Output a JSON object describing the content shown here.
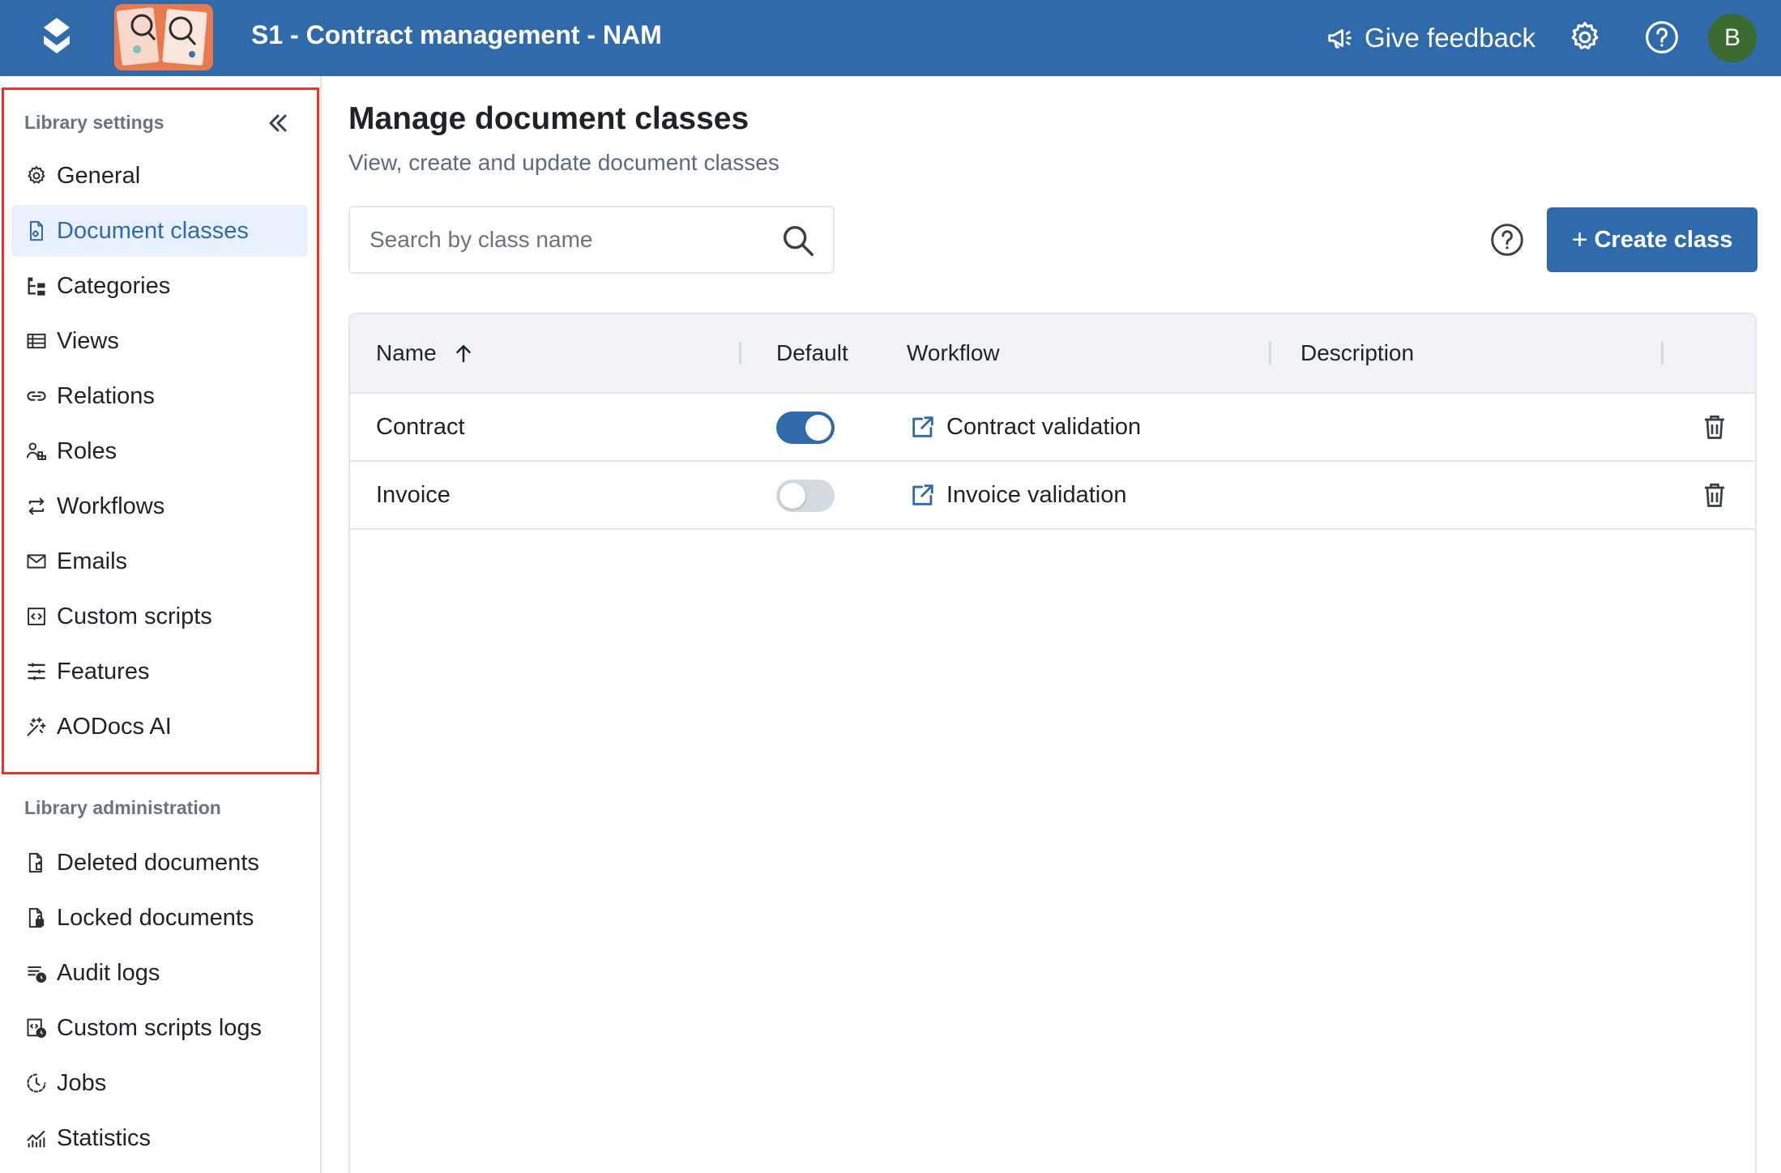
{
  "header": {
    "library_title": "S1 - Contract management - NAM",
    "feedback_label": "Give feedback",
    "avatar_initial": "B"
  },
  "sidebar": {
    "settings_title": "Library settings",
    "settings_items": [
      {
        "label": "General",
        "icon": "gear-icon"
      },
      {
        "label": "Document classes",
        "icon": "document-class-icon",
        "active": true
      },
      {
        "label": "Categories",
        "icon": "categories-icon"
      },
      {
        "label": "Views",
        "icon": "views-icon"
      },
      {
        "label": "Relations",
        "icon": "link-icon"
      },
      {
        "label": "Roles",
        "icon": "roles-icon"
      },
      {
        "label": "Workflows",
        "icon": "workflow-icon"
      },
      {
        "label": "Emails",
        "icon": "email-icon"
      },
      {
        "label": "Custom scripts",
        "icon": "code-icon"
      },
      {
        "label": "Features",
        "icon": "sliders-icon"
      },
      {
        "label": "AODocs AI",
        "icon": "sparkle-icon"
      }
    ],
    "admin_title": "Library administration",
    "admin_items": [
      {
        "label": "Deleted documents",
        "icon": "deleted-document-icon"
      },
      {
        "label": "Locked documents",
        "icon": "locked-document-icon"
      },
      {
        "label": "Audit logs",
        "icon": "audit-log-icon"
      },
      {
        "label": "Custom scripts logs",
        "icon": "script-log-icon"
      },
      {
        "label": "Jobs",
        "icon": "jobs-icon"
      },
      {
        "label": "Statistics",
        "icon": "statistics-icon"
      }
    ]
  },
  "main": {
    "title": "Manage document classes",
    "subtitle": "View, create and update document classes",
    "search_placeholder": "Search by class name",
    "create_label": "Create class",
    "create_plus": "+"
  },
  "table": {
    "columns": {
      "name": "Name",
      "default": "Default",
      "workflow": "Workflow",
      "description": "Description"
    },
    "rows": [
      {
        "name": "Contract",
        "default": true,
        "workflow": "Contract validation",
        "description": ""
      },
      {
        "name": "Invoice",
        "default": false,
        "workflow": "Invoice validation",
        "description": ""
      }
    ]
  },
  "colors": {
    "primary": "#2f6aab",
    "highlight_border": "#e3342f",
    "avatar": "#3b6a2f"
  }
}
